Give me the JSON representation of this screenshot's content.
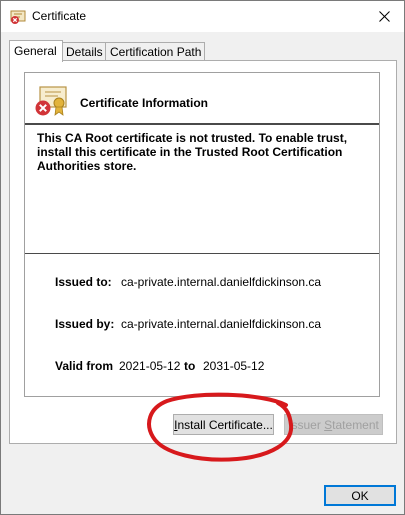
{
  "window": {
    "title": "Certificate"
  },
  "tabs": [
    {
      "label": "General"
    },
    {
      "label": "Details"
    },
    {
      "label": "Certification Path"
    }
  ],
  "general": {
    "heading": "Certificate Information",
    "warning": "This CA Root certificate is not trusted. To enable trust, install this certificate in the Trusted Root Certification Authorities store.",
    "issued_to_label": "Issued to:",
    "issued_to": "ca-private.internal.danielfdickinson.ca",
    "issued_by_label": "Issued by:",
    "issued_by": "ca-private.internal.danielfdickinson.ca",
    "valid_from_label": "Valid from",
    "valid_from": "2021-05-12",
    "valid_to_label": "to",
    "valid_to": "2031-05-12"
  },
  "buttons": {
    "install_prefix": "I",
    "install_rest": "nstall Certificate...",
    "issuer_prefix": "I",
    "issuer_middle": "ssuer ",
    "issuer_s": "S",
    "issuer_rest": "tatement",
    "ok": "OK"
  },
  "colors": {
    "annotation": "#d7191c",
    "accent": "#0078d7",
    "error": "#d13438"
  }
}
